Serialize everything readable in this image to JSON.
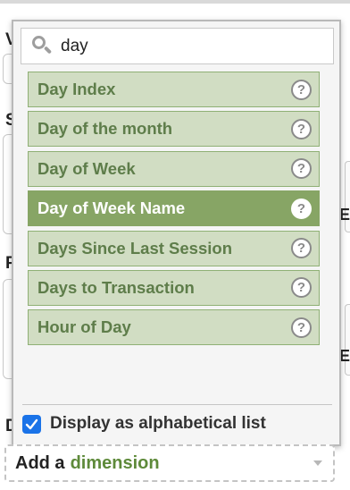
{
  "background": {
    "fragments": [
      "V",
      "S",
      "P",
      "D"
    ],
    "right_fragments": [
      "E",
      "E"
    ]
  },
  "search": {
    "value": "day",
    "placeholder": ""
  },
  "dimension_list": {
    "items": [
      {
        "label": "Day Index",
        "selected": false
      },
      {
        "label": "Day of the month",
        "selected": false
      },
      {
        "label": "Day of Week",
        "selected": false
      },
      {
        "label": "Day of Week Name",
        "selected": true
      },
      {
        "label": "Days Since Last Session",
        "selected": false
      },
      {
        "label": "Days to Transaction",
        "selected": false
      },
      {
        "label": "Hour of Day",
        "selected": false
      }
    ],
    "help_glyph": "?"
  },
  "alphabetical": {
    "label": "Display as alphabetical list",
    "checked": true
  },
  "add_dimension": {
    "prefix": "Add a",
    "word": "dimension"
  },
  "colors": {
    "item_bg": "#d1ddc3",
    "item_text": "#5e7d4a",
    "selected_bg": "#87a565",
    "checkbox": "#1a73e8"
  }
}
